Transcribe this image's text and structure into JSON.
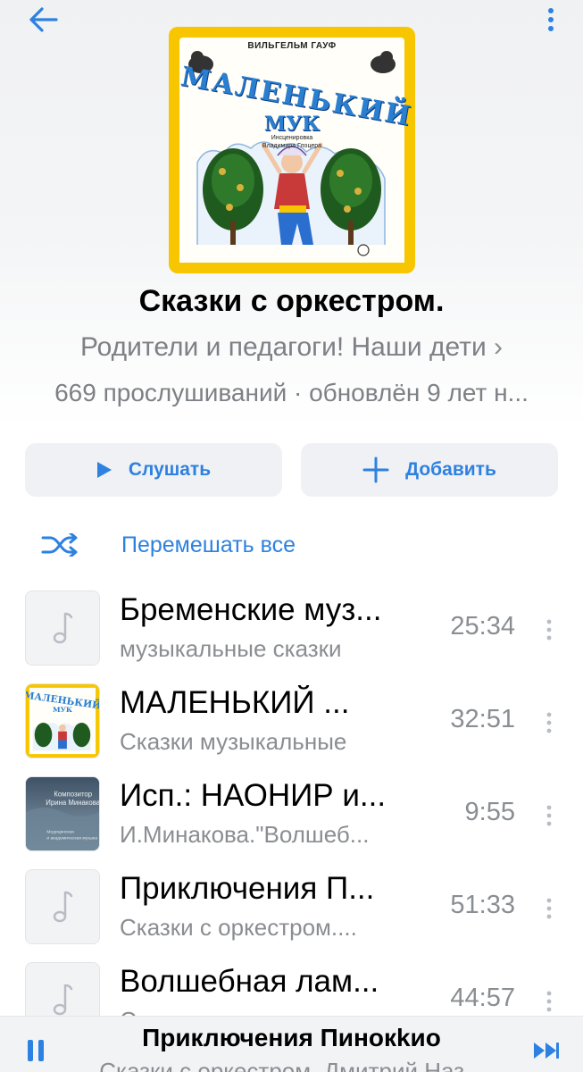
{
  "header": {
    "back_icon": "arrow-left-icon",
    "menu_icon": "more-vertical-icon"
  },
  "cover": {
    "author": "ВИЛЬГЕЛЬМ ГАУФ",
    "title_line1": "МАЛЕНЬКИЙ",
    "title_line2": "МУК",
    "credit_line1": "Инсценировка",
    "credit_line2": "Владимира Глоцера",
    "accent": "#f7c600"
  },
  "playlist": {
    "title": "Сказки с оркестром.",
    "description": "Родители и педагоги! Наши дети",
    "description_chevron": "›",
    "stats": "669 прослушиваний · обновлён 9 лет н..."
  },
  "actions": {
    "listen_label": "Слушать",
    "add_label": "Добавить",
    "shuffle_label": "Перемешать все"
  },
  "tracks": [
    {
      "title": "Бременские муз...",
      "subtitle": "музыкальные сказки",
      "duration": "25:34",
      "thumb": "music-note"
    },
    {
      "title": "МАЛЕНЬКИЙ   ...",
      "subtitle": "Сказки музыкальные",
      "duration": "32:51",
      "thumb": "cover-art"
    },
    {
      "title": "Исп.: НАОНИР и...",
      "subtitle": "И.Минакова.\"Волшеб...",
      "duration": "9:55",
      "thumb": "album-art"
    },
    {
      "title": "Приключения П...",
      "subtitle": "Сказки с оркестром....",
      "duration": "51:33",
      "thumb": "music-note"
    },
    {
      "title": "Волшебная лам...",
      "subtitle": "Сказки с оркестром....",
      "duration": "44:57",
      "thumb": "music-note"
    }
  ],
  "thumb_text": {
    "composer": "Композитор",
    "composer_name": "Ирина Минакова",
    "label1": "Медицинская",
    "label2": "и академическая музыка"
  },
  "player": {
    "title": "Приключения Пинокkио",
    "subtitle": "Сказки с оркестром. Дмитрий Наз..."
  },
  "colors": {
    "accent": "#2d81e0",
    "secondary_text": "#8a8d92",
    "button_bg": "#f0f1f4"
  }
}
